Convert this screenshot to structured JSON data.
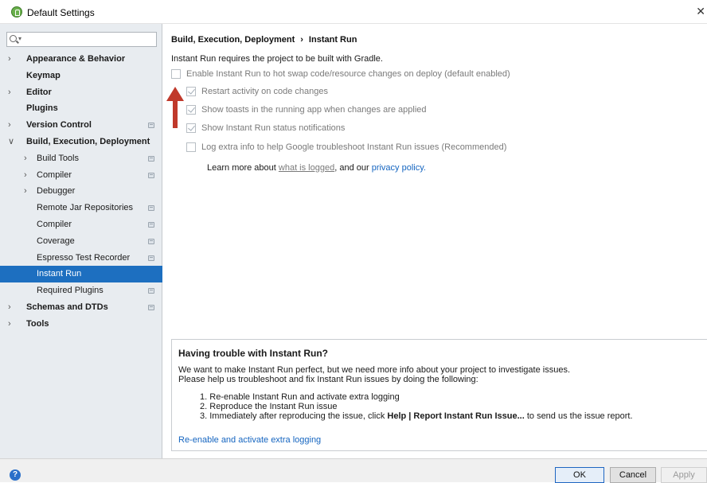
{
  "window": {
    "title": "Default Settings",
    "close_glyph": "✕"
  },
  "search": {
    "value": ""
  },
  "sidebar": {
    "items": [
      {
        "label": "Appearance & Behavior",
        "level": 0,
        "arrow": "right",
        "bold": true,
        "proj": false,
        "selected": false
      },
      {
        "label": "Keymap",
        "level": 0,
        "arrow": null,
        "bold": true,
        "proj": false,
        "selected": false
      },
      {
        "label": "Editor",
        "level": 0,
        "arrow": "right",
        "bold": true,
        "proj": false,
        "selected": false
      },
      {
        "label": "Plugins",
        "level": 0,
        "arrow": null,
        "bold": true,
        "proj": false,
        "selected": false
      },
      {
        "label": "Version Control",
        "level": 0,
        "arrow": "right",
        "bold": true,
        "proj": true,
        "selected": false
      },
      {
        "label": "Build, Execution, Deployment",
        "level": 0,
        "arrow": "down",
        "bold": true,
        "proj": false,
        "selected": false
      },
      {
        "label": "Build Tools",
        "level": 1,
        "arrow": "right",
        "bold": false,
        "proj": true,
        "selected": false
      },
      {
        "label": "Compiler",
        "level": 1,
        "arrow": "right",
        "bold": false,
        "proj": true,
        "selected": false
      },
      {
        "label": "Debugger",
        "level": 1,
        "arrow": "right",
        "bold": false,
        "proj": false,
        "selected": false
      },
      {
        "label": "Remote Jar Repositories",
        "level": 2,
        "arrow": null,
        "bold": false,
        "proj": true,
        "selected": false
      },
      {
        "label": "Compiler",
        "level": 2,
        "arrow": null,
        "bold": false,
        "proj": true,
        "selected": false
      },
      {
        "label": "Coverage",
        "level": 2,
        "arrow": null,
        "bold": false,
        "proj": true,
        "selected": false
      },
      {
        "label": "Espresso Test Recorder",
        "level": 2,
        "arrow": null,
        "bold": false,
        "proj": true,
        "selected": false
      },
      {
        "label": "Instant Run",
        "level": 2,
        "arrow": null,
        "bold": false,
        "proj": false,
        "selected": true
      },
      {
        "label": "Required Plugins",
        "level": 2,
        "arrow": null,
        "bold": false,
        "proj": true,
        "selected": false
      },
      {
        "label": "Schemas and DTDs",
        "level": 0,
        "arrow": "right",
        "bold": true,
        "proj": true,
        "selected": false
      },
      {
        "label": "Tools",
        "level": 0,
        "arrow": "right",
        "bold": true,
        "proj": false,
        "selected": false
      }
    ]
  },
  "main": {
    "breadcrumb": {
      "parent": "Build, Execution, Deployment",
      "sep": "›",
      "current": "Instant Run"
    },
    "requirement_text": "Instant Run requires the project to be built with Gradle.",
    "options": [
      {
        "label": "Enable Instant Run to hot swap code/resource changes on deploy (default enabled)",
        "checked": false
      },
      {
        "label": "Restart activity on code changes",
        "checked": true
      },
      {
        "label": "Show toasts in the running app when changes are applied",
        "checked": true
      },
      {
        "label": "Show Instant Run status notifications",
        "checked": true
      },
      {
        "label": "Log extra info to help Google troubleshoot Instant Run issues (Recommended)",
        "checked": false
      }
    ],
    "learn_more": {
      "prefix": "Learn more about ",
      "link1": "what is logged",
      "middle": ", and our ",
      "link2": "privacy policy."
    },
    "annotation_arrow_color": "#c0392b",
    "trouble": {
      "heading": "Having trouble with Instant Run?",
      "para1": "We want to make Instant Run perfect, but we need more info about your project to investigate issues.",
      "para2": "Please help us troubleshoot and fix Instant Run issues by doing the following:",
      "steps": [
        {
          "num": "1.",
          "text": "Re-enable Instant Run and activate extra logging"
        },
        {
          "num": "2.",
          "text": "Reproduce the Instant Run issue"
        },
        {
          "num": "3.",
          "before": "Immediately after reproducing the issue, click ",
          "bold": "Help | Report Instant Run Issue...",
          "after": " to send us the issue report."
        }
      ],
      "link": "Re-enable and activate extra logging"
    }
  },
  "footer": {
    "help": "?",
    "ok": "OK",
    "cancel": "Cancel",
    "apply": "Apply"
  }
}
